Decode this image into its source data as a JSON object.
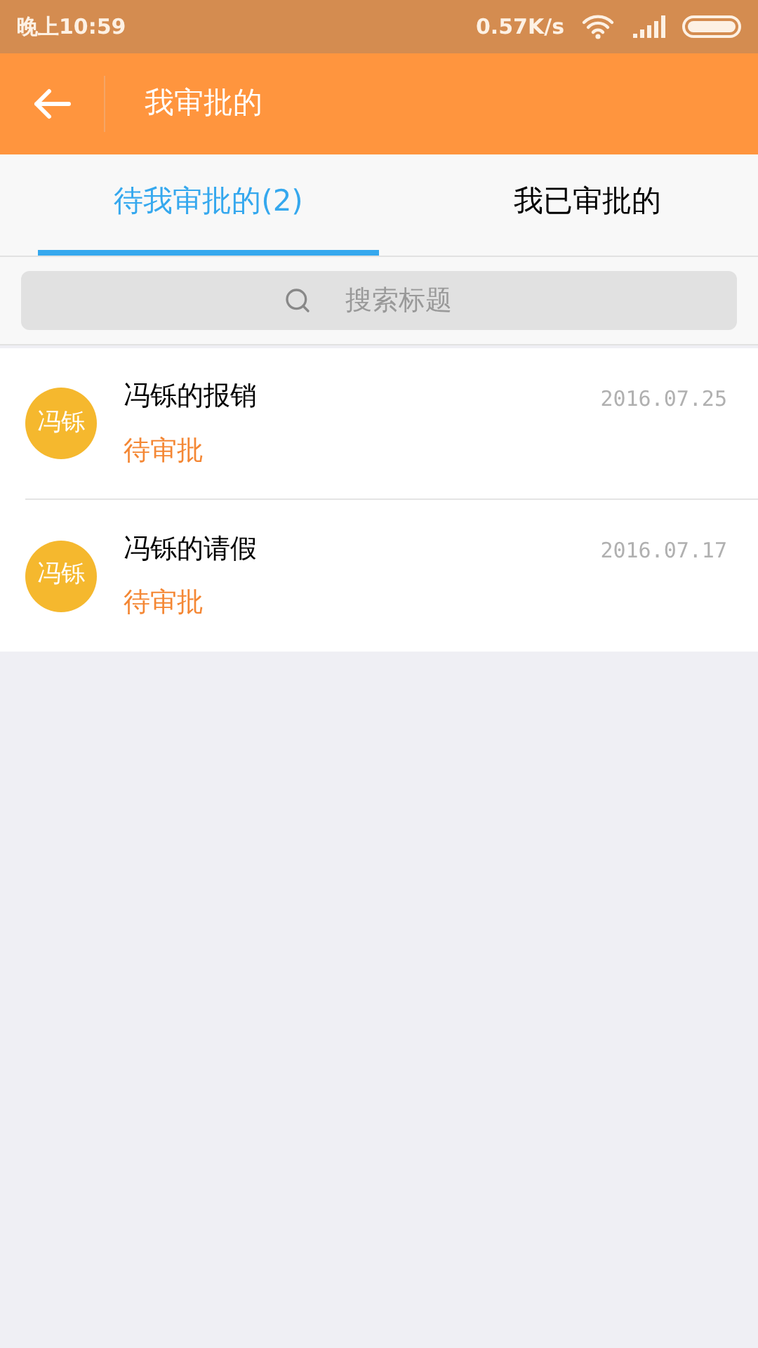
{
  "status_bar": {
    "time": "晚上10:59",
    "speed": "0.57K/s"
  },
  "header": {
    "title": "我审批的"
  },
  "tabs": [
    {
      "label": "待我审批的(2)",
      "selected": true
    },
    {
      "label": "我已审批的",
      "selected": false
    }
  ],
  "search": {
    "placeholder": "搜索标题"
  },
  "items": [
    {
      "avatar": "冯铄",
      "title": "冯铄的报销",
      "status": "待审批",
      "date": "2016.07.25"
    },
    {
      "avatar": "冯铄",
      "title": "冯铄的请假",
      "status": "待审批",
      "date": "2016.07.17"
    }
  ]
}
